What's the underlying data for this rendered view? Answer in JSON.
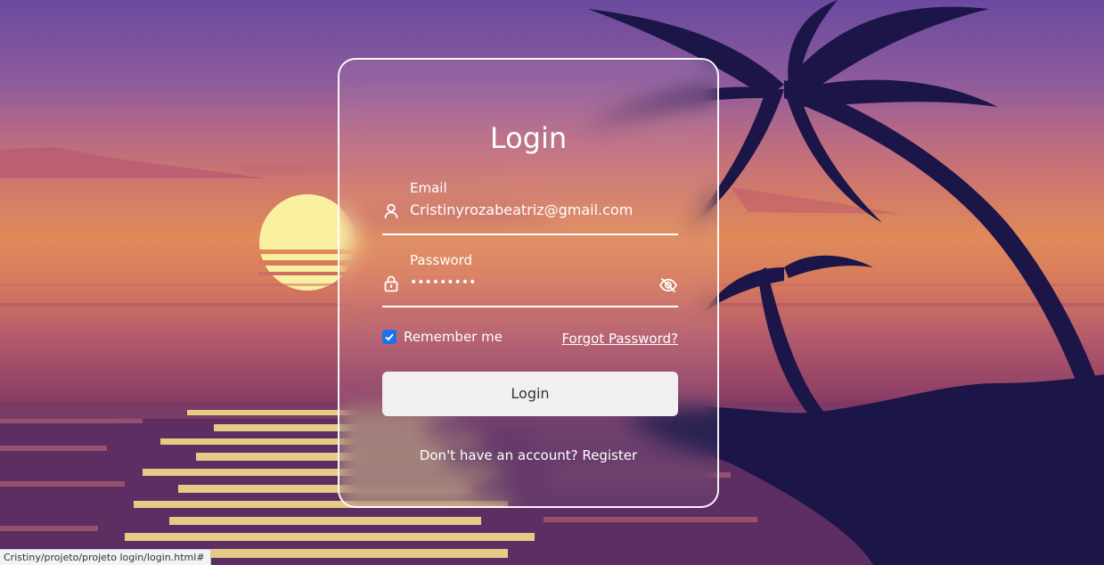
{
  "login_card": {
    "title": "Login",
    "email": {
      "label": "Email",
      "value": "Cristinyrozabeatriz@gmail.com",
      "icon": "user-icon"
    },
    "password": {
      "label": "Password",
      "value": "•••••••••",
      "icon": "lock-icon",
      "toggle_icon": "eye-off-icon"
    },
    "remember_me": {
      "label": "Remember me",
      "checked": true
    },
    "forgot_password": "Forgot Password?",
    "login_button": "Login",
    "register_prompt": "Don't have an account?",
    "register_link": "Register"
  },
  "status_bar": {
    "url": "Cristiny/projeto/projeto login/login.html#"
  },
  "colors": {
    "checkbox_accent": "#1a73e8",
    "button_bg": "#f0f0f0",
    "sky_top": "#6a4aa0",
    "sun": "#fbf0a0",
    "palm_silhouette": "#1c1548"
  }
}
